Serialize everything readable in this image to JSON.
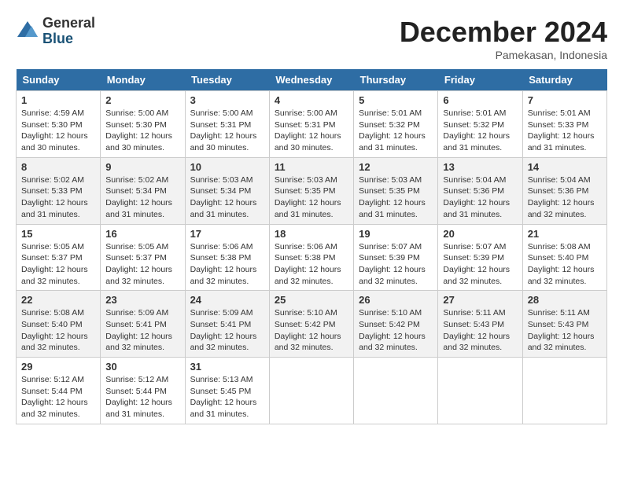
{
  "header": {
    "logo": {
      "line1": "General",
      "line2": "Blue"
    },
    "title": "December 2024",
    "location": "Pamekasan, Indonesia"
  },
  "weekdays": [
    "Sunday",
    "Monday",
    "Tuesday",
    "Wednesday",
    "Thursday",
    "Friday",
    "Saturday"
  ],
  "weeks": [
    [
      {
        "day": "1",
        "sunrise": "4:59 AM",
        "sunset": "5:30 PM",
        "daylight": "12 hours and 30 minutes."
      },
      {
        "day": "2",
        "sunrise": "5:00 AM",
        "sunset": "5:30 PM",
        "daylight": "12 hours and 30 minutes."
      },
      {
        "day": "3",
        "sunrise": "5:00 AM",
        "sunset": "5:31 PM",
        "daylight": "12 hours and 30 minutes."
      },
      {
        "day": "4",
        "sunrise": "5:00 AM",
        "sunset": "5:31 PM",
        "daylight": "12 hours and 30 minutes."
      },
      {
        "day": "5",
        "sunrise": "5:01 AM",
        "sunset": "5:32 PM",
        "daylight": "12 hours and 31 minutes."
      },
      {
        "day": "6",
        "sunrise": "5:01 AM",
        "sunset": "5:32 PM",
        "daylight": "12 hours and 31 minutes."
      },
      {
        "day": "7",
        "sunrise": "5:01 AM",
        "sunset": "5:33 PM",
        "daylight": "12 hours and 31 minutes."
      }
    ],
    [
      {
        "day": "8",
        "sunrise": "5:02 AM",
        "sunset": "5:33 PM",
        "daylight": "12 hours and 31 minutes."
      },
      {
        "day": "9",
        "sunrise": "5:02 AM",
        "sunset": "5:34 PM",
        "daylight": "12 hours and 31 minutes."
      },
      {
        "day": "10",
        "sunrise": "5:03 AM",
        "sunset": "5:34 PM",
        "daylight": "12 hours and 31 minutes."
      },
      {
        "day": "11",
        "sunrise": "5:03 AM",
        "sunset": "5:35 PM",
        "daylight": "12 hours and 31 minutes."
      },
      {
        "day": "12",
        "sunrise": "5:03 AM",
        "sunset": "5:35 PM",
        "daylight": "12 hours and 31 minutes."
      },
      {
        "day": "13",
        "sunrise": "5:04 AM",
        "sunset": "5:36 PM",
        "daylight": "12 hours and 31 minutes."
      },
      {
        "day": "14",
        "sunrise": "5:04 AM",
        "sunset": "5:36 PM",
        "daylight": "12 hours and 32 minutes."
      }
    ],
    [
      {
        "day": "15",
        "sunrise": "5:05 AM",
        "sunset": "5:37 PM",
        "daylight": "12 hours and 32 minutes."
      },
      {
        "day": "16",
        "sunrise": "5:05 AM",
        "sunset": "5:37 PM",
        "daylight": "12 hours and 32 minutes."
      },
      {
        "day": "17",
        "sunrise": "5:06 AM",
        "sunset": "5:38 PM",
        "daylight": "12 hours and 32 minutes."
      },
      {
        "day": "18",
        "sunrise": "5:06 AM",
        "sunset": "5:38 PM",
        "daylight": "12 hours and 32 minutes."
      },
      {
        "day": "19",
        "sunrise": "5:07 AM",
        "sunset": "5:39 PM",
        "daylight": "12 hours and 32 minutes."
      },
      {
        "day": "20",
        "sunrise": "5:07 AM",
        "sunset": "5:39 PM",
        "daylight": "12 hours and 32 minutes."
      },
      {
        "day": "21",
        "sunrise": "5:08 AM",
        "sunset": "5:40 PM",
        "daylight": "12 hours and 32 minutes."
      }
    ],
    [
      {
        "day": "22",
        "sunrise": "5:08 AM",
        "sunset": "5:40 PM",
        "daylight": "12 hours and 32 minutes."
      },
      {
        "day": "23",
        "sunrise": "5:09 AM",
        "sunset": "5:41 PM",
        "daylight": "12 hours and 32 minutes."
      },
      {
        "day": "24",
        "sunrise": "5:09 AM",
        "sunset": "5:41 PM",
        "daylight": "12 hours and 32 minutes."
      },
      {
        "day": "25",
        "sunrise": "5:10 AM",
        "sunset": "5:42 PM",
        "daylight": "12 hours and 32 minutes."
      },
      {
        "day": "26",
        "sunrise": "5:10 AM",
        "sunset": "5:42 PM",
        "daylight": "12 hours and 32 minutes."
      },
      {
        "day": "27",
        "sunrise": "5:11 AM",
        "sunset": "5:43 PM",
        "daylight": "12 hours and 32 minutes."
      },
      {
        "day": "28",
        "sunrise": "5:11 AM",
        "sunset": "5:43 PM",
        "daylight": "12 hours and 32 minutes."
      }
    ],
    [
      {
        "day": "29",
        "sunrise": "5:12 AM",
        "sunset": "5:44 PM",
        "daylight": "12 hours and 32 minutes."
      },
      {
        "day": "30",
        "sunrise": "5:12 AM",
        "sunset": "5:44 PM",
        "daylight": "12 hours and 31 minutes."
      },
      {
        "day": "31",
        "sunrise": "5:13 AM",
        "sunset": "5:45 PM",
        "daylight": "12 hours and 31 minutes."
      },
      null,
      null,
      null,
      null
    ]
  ]
}
